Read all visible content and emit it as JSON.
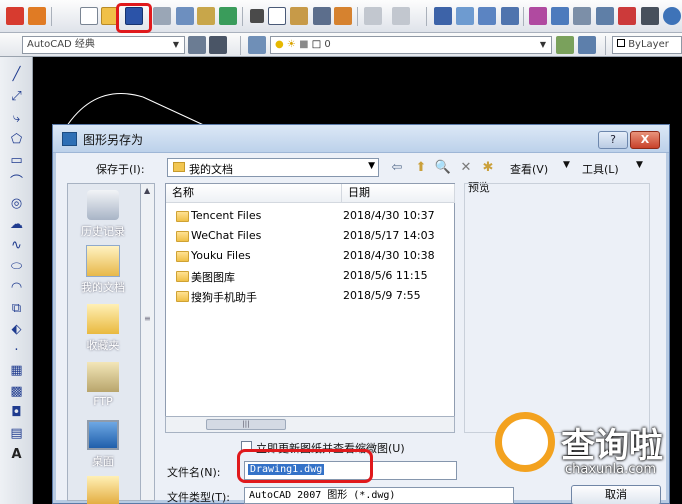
{
  "toolbar": {
    "workspace_combo": "AutoCAD 经典",
    "layer_combo": "0",
    "color_combo": "ByLayer"
  },
  "dialog": {
    "title": "图形另存为",
    "help_label": "?",
    "close_label": "X",
    "save_in_label": "保存于(I):",
    "save_in_value": "我的文档",
    "view_label": "查看(V)",
    "tools_label": "工具(L)",
    "places": [
      {
        "label": "历史记录"
      },
      {
        "label": "我的文档"
      },
      {
        "label": "收藏夹"
      },
      {
        "label": "FTP"
      },
      {
        "label": "桌面"
      }
    ],
    "columns": {
      "name": "名称",
      "date": "日期"
    },
    "files": [
      {
        "name": "Tencent Files",
        "date": "2018/4/30 10:37"
      },
      {
        "name": "WeChat Files",
        "date": "2018/5/17 14:03"
      },
      {
        "name": "Youku Files",
        "date": "2018/4/30 10:38"
      },
      {
        "name": "美图图库",
        "date": "2018/5/6 11:15"
      },
      {
        "name": "搜狗手机助手",
        "date": "2018/5/9 7:55"
      }
    ],
    "preview_label": "预览",
    "thumbnail_checkbox_label": "立即更新图纸并查看缩微图(U)",
    "filename_label": "文件名(N):",
    "filename_value": "Drawing1.dwg",
    "filetype_label": "文件类型(T):",
    "filetype_value": "AutoCAD 2007 图形 (*.dwg)",
    "cancel_label": "取消"
  },
  "watermark": {
    "title": "查询啦",
    "url": "chaxunla.com"
  },
  "colors": {
    "highlight_red": "#e0191c",
    "watermark_orange": "#f3a21f",
    "selection_blue": "#3472c8"
  }
}
